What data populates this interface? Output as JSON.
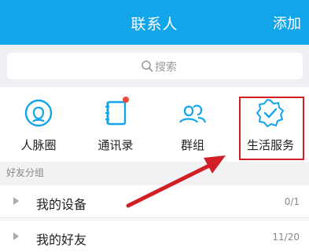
{
  "header": {
    "title": "联系人",
    "add_label": "添加"
  },
  "search": {
    "placeholder": "搜索"
  },
  "services": [
    {
      "label": "人脉圈",
      "icon": "contacts-circle-icon"
    },
    {
      "label": "通讯录",
      "icon": "address-book-icon",
      "badge": "red-dot"
    },
    {
      "label": "群组",
      "icon": "group-icon"
    },
    {
      "label": "生活服务",
      "icon": "life-service-icon"
    }
  ],
  "section": {
    "label": "好友分组"
  },
  "groups": [
    {
      "label": "我的设备",
      "count": "0/1"
    },
    {
      "label": "我的好友",
      "count": "11/20"
    }
  ],
  "colors": {
    "accent": "#13a5ea",
    "highlight": "#d01f25"
  }
}
